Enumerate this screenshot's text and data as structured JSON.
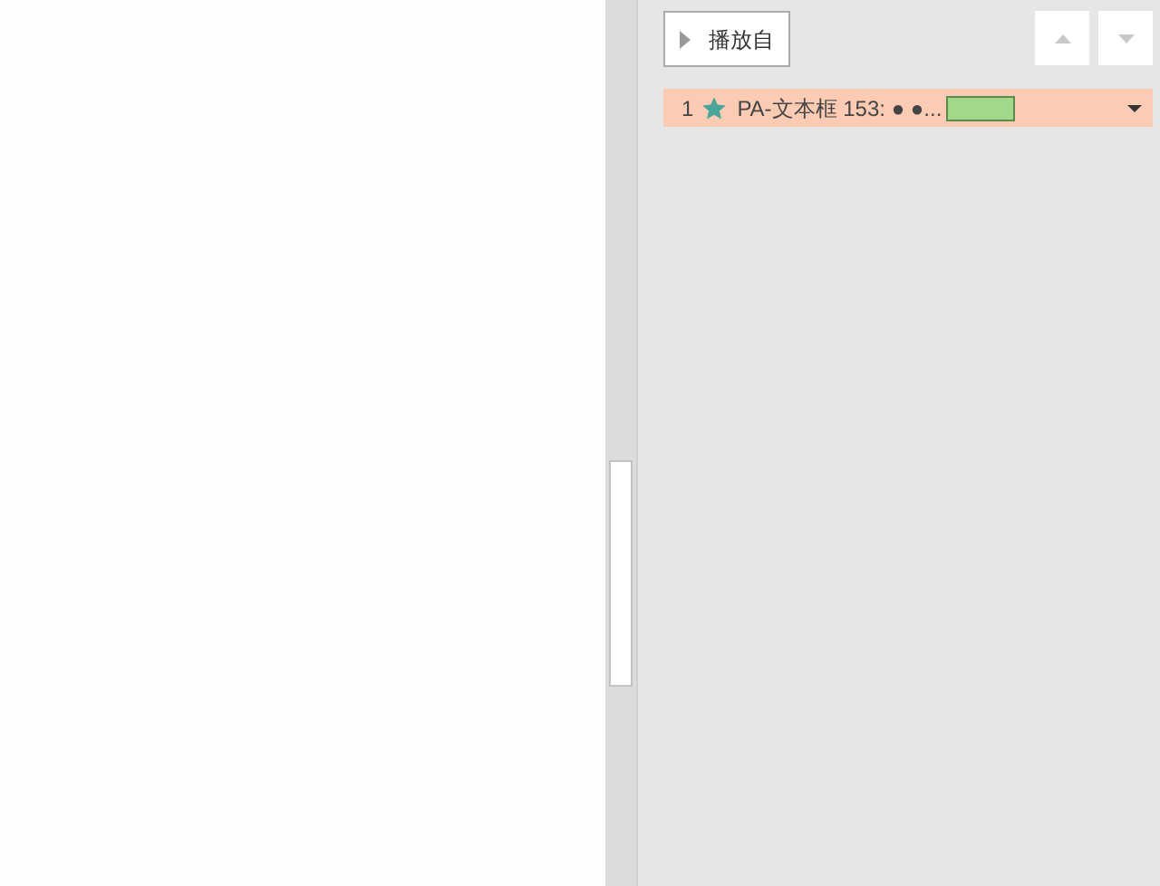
{
  "play_button": {
    "label": "播放自"
  },
  "animations": [
    {
      "number": "1",
      "name": "PA-文本框 153: ● ●...",
      "selected": true
    }
  ]
}
